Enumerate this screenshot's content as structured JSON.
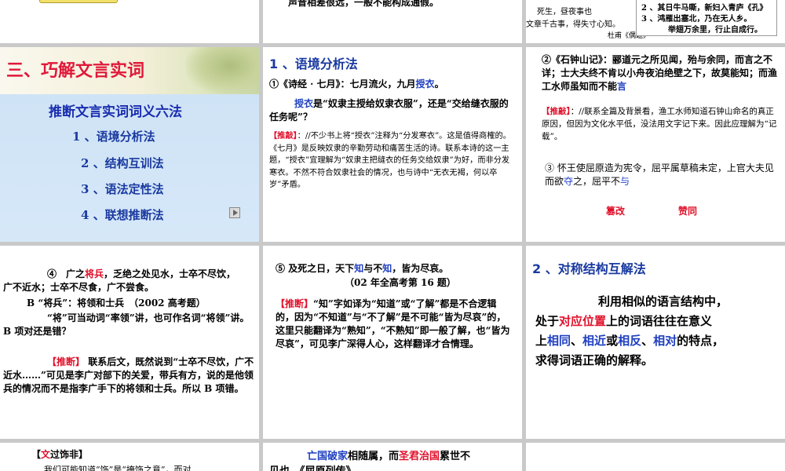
{
  "row1": {
    "s1": {},
    "s2": {
      "text": "声音相差很远，一般不能构成通假。"
    },
    "s3": {
      "left_line1": "死生，昼夜事也",
      "left_line2": "文章千古事，得失寸心知。",
      "left_line3": "杜甫《偶题》",
      "box_line1": "2 、其日牛马嘶，新妇入青庐《孔》",
      "box_line2": "3 、鸿雁出塞北，乃在无人乡。",
      "box_line3": "举翅万余里，行止自成行。"
    }
  },
  "row2": {
    "s1": {
      "title": "三、巧解文言实词",
      "subtitle": "推断文言实词词义六法",
      "items": [
        "1 、语境分析法",
        "2 、结构互训法",
        "3 、语法定性法",
        "4 、联想推断法"
      ],
      "nav_icon": "play-icon"
    },
    "s2": {
      "heading": "1 、语境分析法",
      "ex_prefix": "①《诗经 · 七月》：七月流火，九月",
      "ex_key": "授衣",
      "ex_end": "。",
      "q_key": "授衣",
      "q_rest": "是“奴隶主授给奴隶衣服”，还是“交给缝衣服的任务呢”？",
      "tui_label": "【推敲】",
      "tui_text": "：//不少书上将“授衣”注释为“分发寒衣”。这是值得商榷的。《七月》是反映奴隶的辛勤劳动和痛苦生活的诗。联系本诗的这一主题，“授衣”宜理解为“奴隶主把缝衣的任务交给奴隶”为好，而非分发寒衣。不然不符合奴隶社会的情况，也与诗中“无衣无褐，何以卒岁”矛盾。"
    },
    "s3": {
      "p1": "②《石钟山记》：郦道元之所见闻，殆与余同，而言之不详；士大夫终不肯以小舟夜泊绝壁之下，故莫能知；而渔工水师虽知而不能",
      "p1_key": "言",
      "tui_label": "【推敲】",
      "tui_text": "：//联系全篇及背景看，渔工水师知道石钟山命名的真正原因，但因为文化水平低，没法用文字记下来。因此应理解为“记载”。",
      "p2": "③ 怀王使屈原造为宪令，屈平属草稿未定，上官大夫见而欲",
      "p2_key1": "夺",
      "p2_mid": "之，屈平不",
      "p2_key2": "与",
      "ann1": "篡改",
      "ann2": "赞同"
    }
  },
  "row3": {
    "s1": {
      "p1_pre": "④　广之",
      "p1_key": "将兵",
      "p1_post": "，乏绝之处见水，士卒不尽饮，　 广不近水；士卒不尽食，广不尝食。",
      "p2": "B “将兵”：将领和士兵　（2002 高考题）",
      "p3": "“将”可当动词“率领”讲，也可作名词“将领”讲。　B 项对还是错？",
      "tui_label": "【推断】",
      "tui_text": "联系后文，既然说到“士卒不尽饮，广不近水……”可见是李广对部下的关爱，带兵有方，说的是他领兵的情况而不是指李广手下的将领和士兵。所以 B 项错。"
    },
    "s2": {
      "p1_pre": "⑤ 及死之日，天下",
      "p1_key1": "知",
      "p1_mid": "与不",
      "p1_key2": "知",
      "p1_post": "，皆为尽哀。",
      "p2": "（02 年全高考第 16 题）",
      "tui_label": "【推断】",
      "tui_text": "“知”字如译为“知道”或“了解”都是不合逻辑的，因为“不知道”与“不了解”是不可能“皆为尽哀”的，这里只能翻译为“熟知”，“不熟知”即一般了解，也“皆为尽哀”，可见李广深得人心，这样翻译才合情理。"
    },
    "s3": {
      "heading": "2 、对称结构互解法",
      "t1": "利用相似的语言结构中，",
      "t2_pre": "处于",
      "t2_key": "对应位置",
      "t2_post": "上的词语往往在意义",
      "t3_pre": "上",
      "t3_k1": "相同",
      "t3_s1": "、",
      "t3_k2": "相近",
      "t3_s2": "或",
      "t3_k3": "相反",
      "t3_s3": "、",
      "t3_k4": "相对",
      "t3_post": "的特点，",
      "t4": "求得词语正确的解释。"
    }
  },
  "row4": {
    "s1": {
      "bracket_open": "【",
      "key": "文",
      "rest": "过饰非】",
      "p1": "我们可能知道“饰”是“掩饰之意”，而对"
    },
    "s2": {
      "k1": "亡国破家",
      "m1": "相随属，而",
      "k2": "圣君治国",
      "m2": "累世不",
      "p2": "见也。《屈原列传》"
    },
    "s3": {}
  },
  "colors": {
    "red": "#e0102a",
    "blue": "#2040c0",
    "grid_bg": "#c9c9c9",
    "title_red": "#e0183a",
    "subtitle_blue": "#1a2db0",
    "panel_light_blue": "#cfe3f6"
  }
}
